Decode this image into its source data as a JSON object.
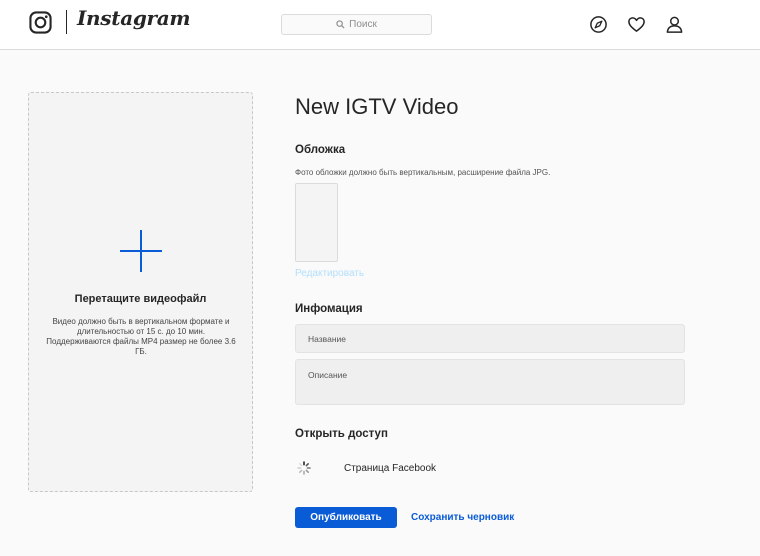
{
  "header": {
    "brand": "Instagram",
    "search_placeholder": "Поиск",
    "icons": [
      "instagram-logo-icon",
      "search-icon",
      "explore-compass-icon",
      "heart-icon",
      "profile-icon"
    ]
  },
  "upload": {
    "title": "Перетащите видеофайл",
    "description": "Видео должно быть в вертикальном формате и длительностью от 15 с. до 10 мин. Поддерживаются файлы MP4 размер не более 3.6 ГБ.",
    "icon": "plus-icon"
  },
  "form": {
    "page_title": "New IGTV Video",
    "cover": {
      "title": "Обложка",
      "hint": "Фото обложки должно быть вертикальным, расширение файла JPG.",
      "edit_label": "Редактировать"
    },
    "info": {
      "title": "Инфомация",
      "name_placeholder": "Название",
      "description_placeholder": "Описание"
    },
    "access": {
      "title": "Открыть доступ",
      "facebook_label": "Страница Facebook",
      "icon": "loading-spinner-icon"
    },
    "publish_label": "Опубликовать",
    "draft_label": "Сохранить черновик"
  },
  "colors": {
    "accent": "#0a5bd6",
    "link_disabled": "#b2dffc",
    "border": "#dbdbdb",
    "background": "#fafafa"
  }
}
